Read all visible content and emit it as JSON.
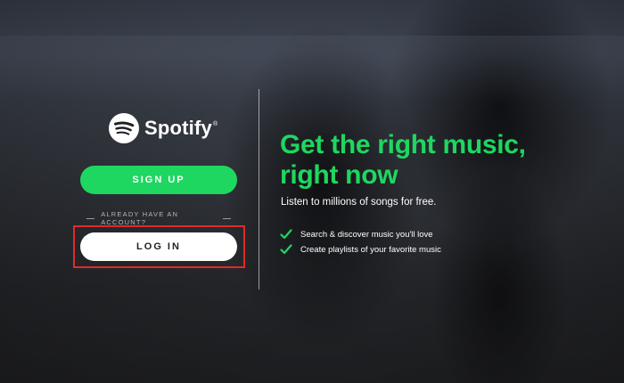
{
  "brand": {
    "name": "Spotify",
    "trademark": "®",
    "logo_icon": "spotify-logo-icon",
    "accent_color": "#1ed760"
  },
  "actions": {
    "signup_label": "SIGN UP",
    "already_label": "ALREADY HAVE AN ACCOUNT?",
    "login_label": "LOG IN"
  },
  "promo": {
    "headline_line1": "Get the right music,",
    "headline_line2": "right now",
    "subline": "Listen to millions of songs for free.",
    "features": [
      {
        "icon": "check-icon",
        "label": "Search & discover music you'll love"
      },
      {
        "icon": "check-icon",
        "label": "Create playlists of your favorite music"
      }
    ]
  },
  "annotation": {
    "highlight_color": "#e02a2a",
    "target": "login-button"
  }
}
